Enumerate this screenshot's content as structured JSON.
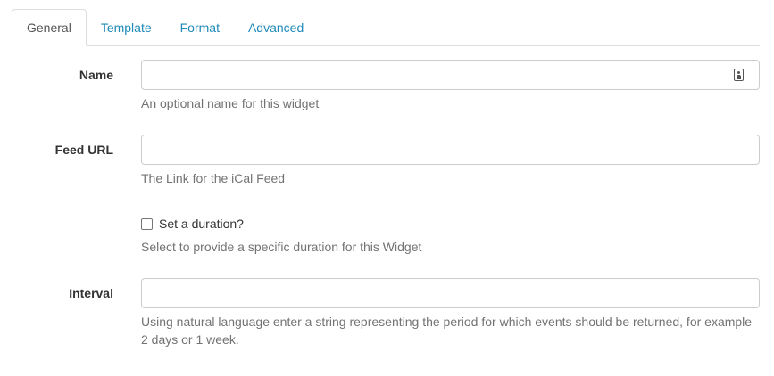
{
  "tabs": [
    {
      "label": "General",
      "active": true
    },
    {
      "label": "Template",
      "active": false
    },
    {
      "label": "Format",
      "active": false
    },
    {
      "label": "Advanced",
      "active": false
    }
  ],
  "fields": {
    "name": {
      "label": "Name",
      "value": "",
      "placeholder": "",
      "help": "An optional name for this widget",
      "icon": "contact-card-icon"
    },
    "feed_url": {
      "label": "Feed URL",
      "value": "",
      "placeholder": "",
      "help": "The Link for the iCal Feed"
    },
    "duration": {
      "label": "Set a duration?",
      "checked": false,
      "help": "Select to provide a specific duration for this Widget"
    },
    "interval": {
      "label": "Interval",
      "value": "",
      "placeholder": "",
      "help": "Using natural language enter a string representing the period for which events should be returned, for example 2 days or 1 week."
    }
  },
  "colors": {
    "link": "#1f8ab8",
    "border": "#cccccc",
    "help_text": "#737373"
  }
}
